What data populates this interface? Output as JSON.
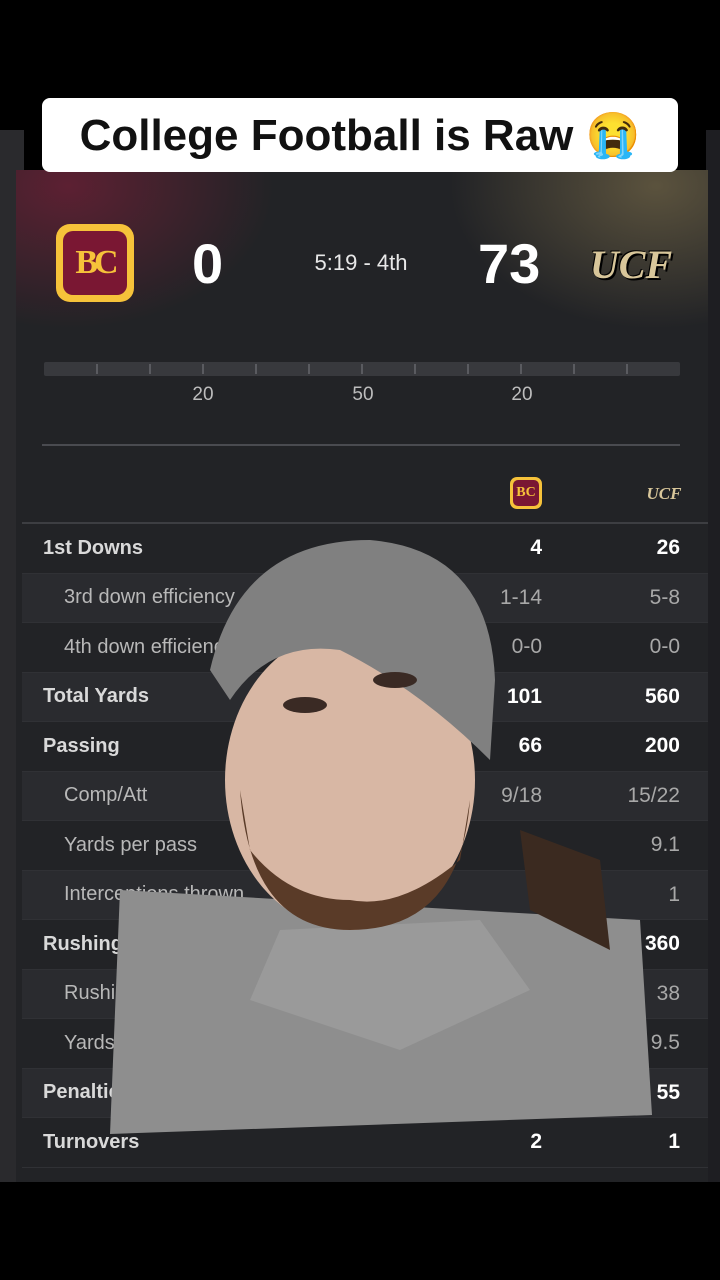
{
  "caption": "College Football is Raw 😭",
  "game": {
    "home_logo": "BC",
    "home_score": "0",
    "clock": "5:19 - 4th",
    "away_score": "73",
    "away_logo": "UCF"
  },
  "field": {
    "yard_labels": [
      "20",
      "50",
      "20"
    ]
  },
  "table": {
    "home_logo": "BC",
    "away_logo": "UCF",
    "rows": [
      {
        "label": "1st Downs",
        "home": "4",
        "away": "26",
        "type": "main"
      },
      {
        "label": "3rd down efficiency",
        "home": "1-14",
        "away": "5-8",
        "type": "sub"
      },
      {
        "label": "4th down efficiency",
        "home": "0-0",
        "away": "0-0",
        "type": "sub"
      },
      {
        "label": "Total Yards",
        "home": "101",
        "away": "560",
        "type": "main"
      },
      {
        "label": "Passing",
        "home": "66",
        "away": "200",
        "type": "main"
      },
      {
        "label": "Comp/Att",
        "home": "9/18",
        "away": "15/22",
        "type": "sub"
      },
      {
        "label": "Yards per pass",
        "home": "",
        "away": "9.1",
        "type": "sub"
      },
      {
        "label": "Interceptions thrown",
        "home": "",
        "away": "1",
        "type": "sub"
      },
      {
        "label": "Rushing",
        "home": "",
        "away": "360",
        "type": "main"
      },
      {
        "label": "Rushing Attempts",
        "home": "",
        "away": "38",
        "type": "sub"
      },
      {
        "label": "Yards per rush",
        "home": "",
        "away": "9.5",
        "type": "sub"
      },
      {
        "label": "Penalties",
        "home": "",
        "away": "55",
        "type": "main"
      },
      {
        "label": "Turnovers",
        "home": "2",
        "away": "1",
        "type": "main"
      }
    ]
  },
  "colors": {
    "bc_maroon": "#7a1733",
    "bc_gold": "#f6c23a",
    "ucf_gold": "#d8c69a",
    "panel": "#222326"
  }
}
